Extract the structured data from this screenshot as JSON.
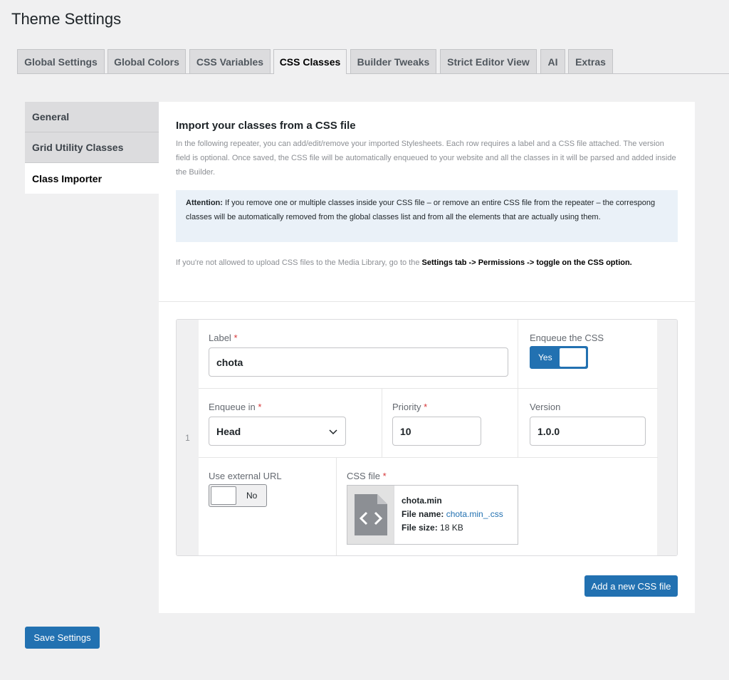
{
  "page": {
    "title": "Theme Settings"
  },
  "tabs": [
    {
      "label": "Global Settings"
    },
    {
      "label": "Global Colors"
    },
    {
      "label": "CSS Variables"
    },
    {
      "label": "CSS Classes",
      "active": true
    },
    {
      "label": "Builder Tweaks"
    },
    {
      "label": "Strict Editor View"
    },
    {
      "label": "AI"
    },
    {
      "label": "Extras"
    }
  ],
  "sidebar": {
    "items": [
      {
        "label": "General"
      },
      {
        "label": "Grid Utility Classes"
      },
      {
        "label": "Class Importer",
        "active": true
      }
    ]
  },
  "main": {
    "title": "Import your classes from a CSS file",
    "description": "In the following repeater, you can add/edit/remove your imported Stylesheets. Each row requires a label and a CSS file attached. The version field is optional. Once saved, the CSS file will be automatically enqueued to your website and all the classes in it will be parsed and added inside the Builder.",
    "attention_label": "Attention:",
    "attention_text": " If you remove one or multiple classes inside your CSS file – or remove an entire CSS file from the repeater – the correspong classes will be automatically removed from the global classes list and from all the elements that are actually using them.",
    "note_text": "If you're not allowed to upload CSS files to the Media Library, go to the ",
    "note_bold": "Settings tab -> Permissions -> toggle on the CSS option."
  },
  "repeater": {
    "row_number": "1",
    "label_field": {
      "label": "Label",
      "required": "*",
      "value": "chota"
    },
    "enqueue_css": {
      "label": "Enqueue the CSS",
      "toggle_text": "Yes",
      "state": "on"
    },
    "enqueue_in": {
      "label": "Enqueue in",
      "required": "*",
      "value": "Head"
    },
    "priority": {
      "label": "Priority",
      "required": "*",
      "value": "10"
    },
    "version": {
      "label": "Version",
      "value": "1.0.0"
    },
    "external_url": {
      "label": "Use external URL",
      "toggle_text": "No",
      "state": "off"
    },
    "css_file": {
      "label": "CSS file",
      "required": "*",
      "title": "chota.min",
      "file_name_label": "File name:",
      "file_name": "chota.min_.css",
      "file_size_label": "File size:",
      "file_size": "18 KB"
    },
    "add_button": "Add a new CSS file"
  },
  "footer": {
    "save_button": "Save Settings"
  },
  "colors": {
    "accent": "#2271b1",
    "required": "#d63638",
    "attention_bg": "#eaf1f8"
  }
}
